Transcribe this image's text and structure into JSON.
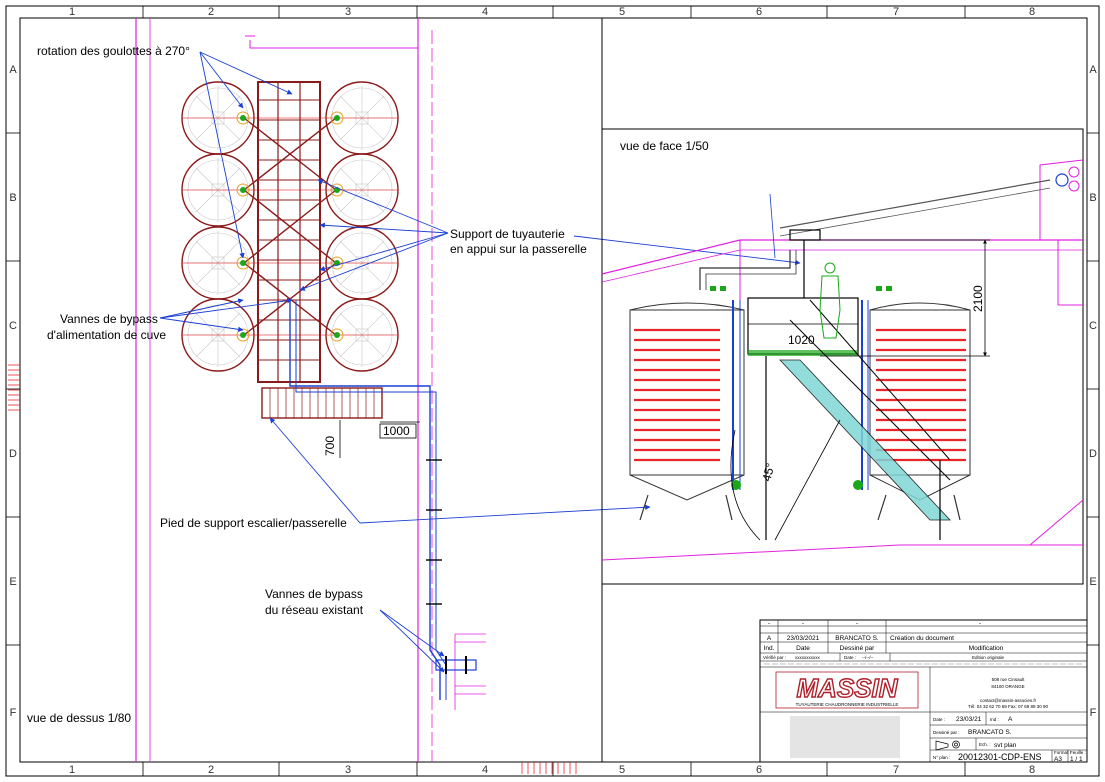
{
  "frame": {
    "columns": [
      "1",
      "2",
      "3",
      "4",
      "5",
      "6",
      "7",
      "8"
    ],
    "rows": [
      "A",
      "B",
      "C",
      "D",
      "E",
      "F"
    ]
  },
  "left_view": {
    "title": "vue de dessus 1/80",
    "callout_rotation": "rotation des goulottes à 270°",
    "callout_support_line1": "Support de tuyauterie",
    "callout_support_line2": "en appui sur la passerelle",
    "callout_bypass_tank_line1": "Vannes de bypass",
    "callout_bypass_tank_line2": "d'alimentation de cuve",
    "callout_stair_foot": "Pied de support escalier/passerelle",
    "callout_bypass_network_line1": "Vannes de bypass",
    "callout_bypass_network_line2": "du réseau existant",
    "dim_700": "700",
    "dim_1000": "1000"
  },
  "right_view": {
    "title": "vue de face 1/50",
    "dim_height": "2100",
    "dim_width": "1020",
    "dim_angle": "45°"
  },
  "title_block": {
    "revision_placeholder": "-",
    "rev_a_ind": "A",
    "rev_a_date": "23/03/2021",
    "rev_a_author": "BRANCATO S.",
    "rev_a_modification": "Création du document",
    "header_ind": "Ind.",
    "header_date": "Date",
    "header_author": "Dessiné par",
    "header_modification": "Modification",
    "verified_label": "Vérifié par :",
    "verified_value": "xxxxxxxxxxx",
    "verified_date_label": "Date :",
    "verified_date_value": "--/--/--",
    "edition": "Edition originale",
    "logo_text": "MASSIN",
    "logo_subtitle": "TUYAUTERIE CHAUDRONNERIE INDUSTRIELLE",
    "address_line1": "508 rue Cinsault",
    "address_line2": "84100 ORANGE",
    "contact_email": "contact@massin-associes.fr",
    "contact_phone": "Tél: 04 32 62 70 69 Fax: 07 69 88 30 90",
    "date_label": "Date :",
    "date_value": "23/03/21",
    "ind_label": "Ind :",
    "ind_value": "A",
    "drawn_by_label": "Dessiné par :",
    "drawn_by_value": "BRANCATO S.",
    "scale_label": "Ech. :",
    "scale_value": "svt plan",
    "plan_no_label": "N° plan :",
    "plan_no_value": "20012301-CDP-ENS",
    "format_label": "Format :",
    "format_value": "A3",
    "sheet_label": "Feuille :",
    "sheet_value": "1 / 1",
    "colors": {
      "logo": "#b0202a",
      "red_pipe": "#e8262a",
      "magenta_structure": "#e020e0",
      "blue_pipe": "#1a3fd4",
      "green": "#1aa81a"
    }
  }
}
